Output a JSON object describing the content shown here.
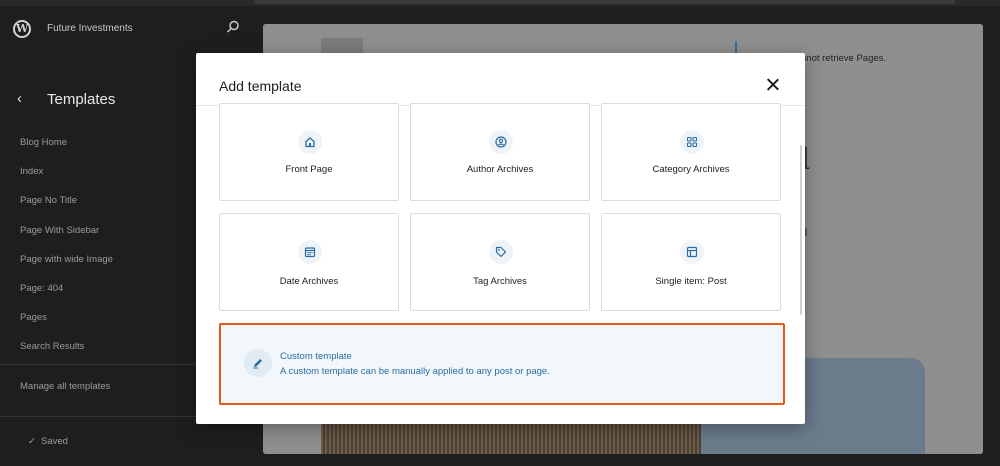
{
  "sidebar": {
    "site_name": "Future Investments",
    "title": "Templates",
    "items": [
      {
        "label": "Blog Home"
      },
      {
        "label": "Index"
      },
      {
        "label": "Page No Title"
      },
      {
        "label": "Page With Sidebar"
      },
      {
        "label": "Page with wide Image"
      },
      {
        "label": "Page: 404"
      },
      {
        "label": "Pages"
      },
      {
        "label": "Search Results"
      }
    ],
    "manage_label": "Manage all templates",
    "saved_label": "Saved",
    "saved_icon": "check-icon"
  },
  "canvas": {
    "error_text": "nnot retrieve Pages.",
    "big_char": "d",
    "small_char": "d"
  },
  "modal": {
    "title": "Add template",
    "close_icon": "close-icon",
    "cards": [
      {
        "label": "Front Page",
        "icon": "home-icon"
      },
      {
        "label": "Author Archives",
        "icon": "author-icon"
      },
      {
        "label": "Category Archives",
        "icon": "category-icon"
      },
      {
        "label": "Date Archives",
        "icon": "calendar-icon"
      },
      {
        "label": "Tag Archives",
        "icon": "tag-icon"
      },
      {
        "label": "Single item: Post",
        "icon": "layout-icon"
      }
    ],
    "custom": {
      "title": "Custom template",
      "description": "A custom template can be manually applied to any post or page.",
      "icon": "pencil-icon"
    }
  },
  "colors": {
    "accent": "#2a6ba3",
    "highlight_border": "#e45a16",
    "sidebar_bg": "#1e1e1e"
  }
}
